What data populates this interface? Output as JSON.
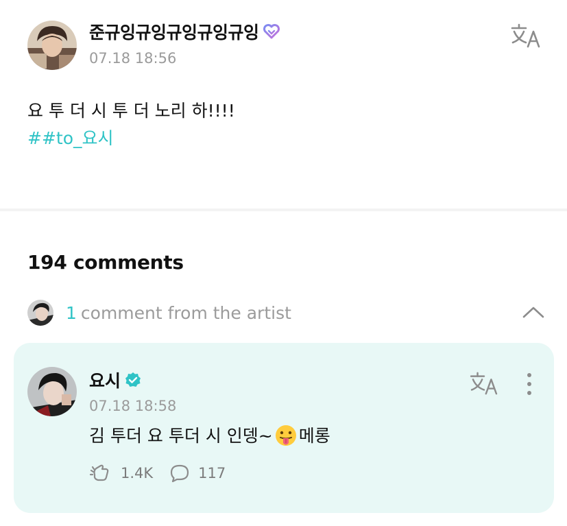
{
  "post": {
    "author": "준규잉규잉규잉규잉규잉",
    "time": "07.18 18:56",
    "text": "요 투 더 시 투 더 노리 하!!!!",
    "hashtag": "##to_요시"
  },
  "comments": {
    "count_label": "194 comments",
    "artist_row": {
      "count": "1",
      "label": "comment from the artist"
    },
    "items": [
      {
        "author": "요시",
        "time": "07.18 18:58",
        "text_before": "김 투더 요 투더 시 인뎅~",
        "emoji": "tongue-out-emoji",
        "text_after": "메롱",
        "likes": "1.4K",
        "replies": "117"
      }
    ]
  },
  "icons": {
    "translate": "translate-icon",
    "verified": "verified-badge-icon",
    "heart_badge": "heart-badge-icon",
    "collapse": "chevron-up-icon",
    "more": "more-vertical-icon",
    "like": "cheer-icon",
    "reply": "comment-bubble-icon"
  },
  "colors": {
    "accent": "#2fc3c6",
    "comment_background": "#e8f8f6",
    "secondary_text": "#9b9b9b"
  }
}
